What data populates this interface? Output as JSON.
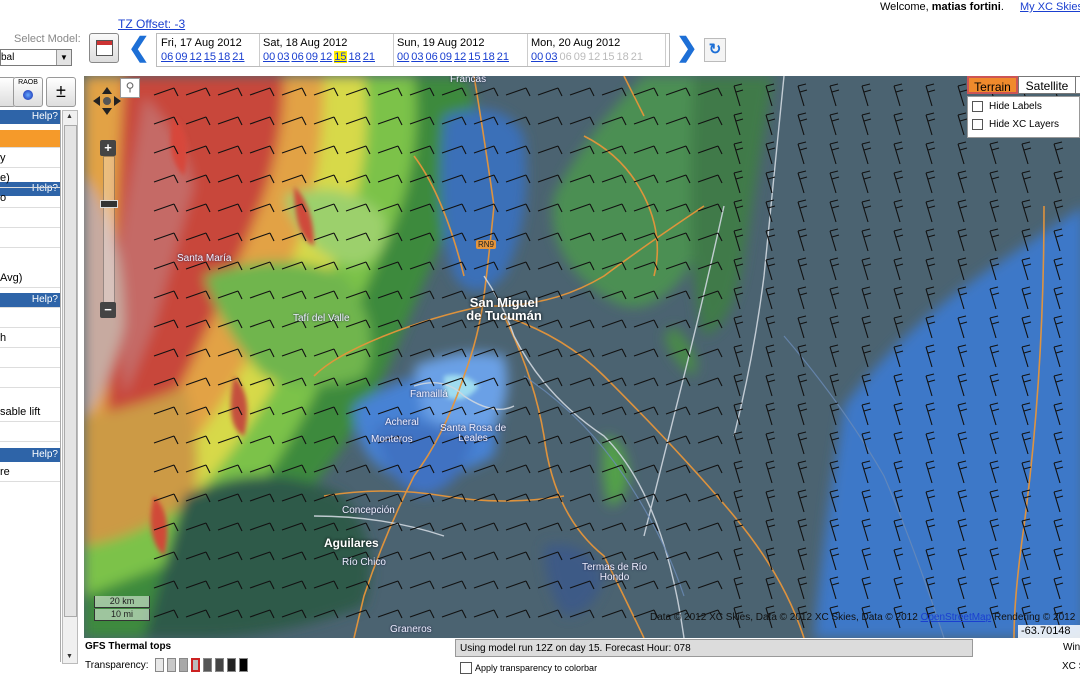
{
  "header": {
    "tz_offset": "TZ Offset: -3",
    "welcome_prefix": "Welcome, ",
    "user_name": "matias fortini",
    "welcome_suffix": ".",
    "my_xc_link": "My XC Skies"
  },
  "model": {
    "label": "Select Model:",
    "value": "bal"
  },
  "days": [
    {
      "label": "Fri, 17 Aug 2012",
      "hours": [
        "06",
        "09",
        "12",
        "15",
        "18",
        "21"
      ],
      "selected": "",
      "disabled": []
    },
    {
      "label": "Sat, 18 Aug 2012",
      "hours": [
        "00",
        "03",
        "06",
        "09",
        "12",
        "15",
        "18",
        "21"
      ],
      "selected": "15",
      "disabled": []
    },
    {
      "label": "Sun, 19 Aug 2012",
      "hours": [
        "00",
        "03",
        "06",
        "09",
        "12",
        "15",
        "18",
        "21"
      ],
      "selected": "",
      "disabled": []
    },
    {
      "label": "Mon, 20 Aug 2012",
      "hours": [
        "00",
        "03",
        "06",
        "09",
        "12",
        "15",
        "18",
        "21"
      ],
      "selected": "",
      "disabled": [
        "06",
        "09",
        "12",
        "15",
        "18",
        "21"
      ]
    }
  ],
  "left_panel": {
    "raob_label": "RAOB",
    "plus_minus": "±",
    "help_label": "Help?",
    "select_value": "s",
    "rows": [
      "",
      "y",
      "e)",
      "o",
      "",
      "",
      "Avg)",
      "",
      "",
      "h",
      "",
      "",
      "sable lift",
      "",
      "",
      "re"
    ]
  },
  "map": {
    "layer_buttons": [
      "Terrain",
      "Satellite"
    ],
    "active_layer": "Terrain",
    "options": [
      "Hide Labels",
      "Hide XC Layers"
    ],
    "place_labels": {
      "francas": "Francas",
      "santa_maria": "Santa María",
      "tafi": "Tafí del Valle",
      "smt_line1": "San Miguel",
      "smt_line2": "de Tucumán",
      "famailla": "Famaillá",
      "acheral": "Acheral",
      "monteros": "Monteros",
      "santa_rosa_line1": "Santa Rosa de",
      "santa_rosa_line2": "Leales",
      "concepcion": "Concepción",
      "aguilares": "Aguilares",
      "rio_chico": "Río Chico",
      "termas_line1": "Termas de Río",
      "termas_line2": "Hondo",
      "graneros": "Graneros",
      "rn9": "RN9"
    },
    "scale_km": "20 km",
    "scale_mi": "10 mi",
    "attribution_pre": "Data © 2012 XC Skies, Data © 2012 XC Skies, Data © 2012 ",
    "attribution_link": "OpenStreetMap",
    "attribution_post": " Rendering © 2012",
    "coords": "-63.70148"
  },
  "bottom": {
    "layer_title": "GFS Thermal tops",
    "transparency_label": "Transparency:",
    "status": "Using model run 12Z on day 15. Forecast Hour: 078",
    "apply_label": "Apply transparency to colorbar",
    "right_label_1": "Win",
    "right_label_2": "XC S"
  },
  "colors": {
    "link": "#1a3fd0",
    "accent_orange": "#f59a2a",
    "help_bar": "#2e64a8",
    "selected_hour": "#ffef00"
  }
}
